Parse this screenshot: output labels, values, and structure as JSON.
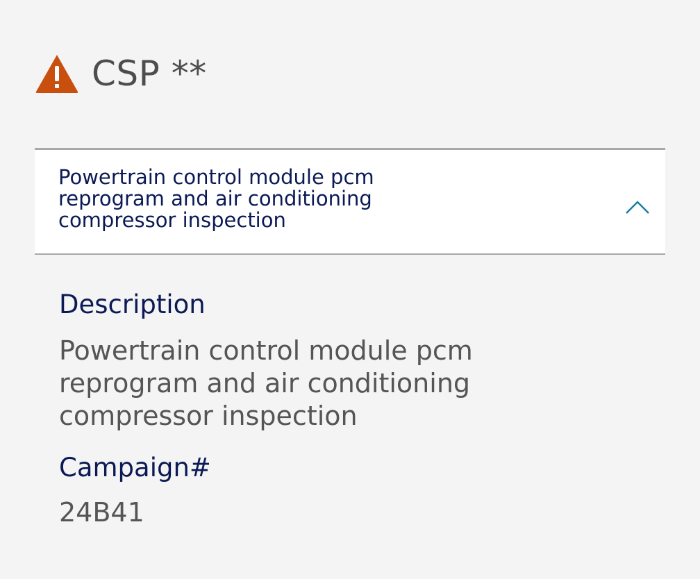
{
  "header": {
    "title": "CSP **",
    "icon": "warning-icon",
    "icon_color": "#c94f0f"
  },
  "accordion": {
    "title": "Powertrain control module pcm reprogram and air conditioning compressor inspection",
    "expanded": true,
    "chevron_icon": "chevron-up-icon",
    "accent_color": "#1a7fa0"
  },
  "details": {
    "description_label": "Description",
    "description_value": "Powertrain control module pcm reprogram and air conditioning compressor inspection",
    "campaign_label": "Campaign#",
    "campaign_value": "24B41"
  }
}
